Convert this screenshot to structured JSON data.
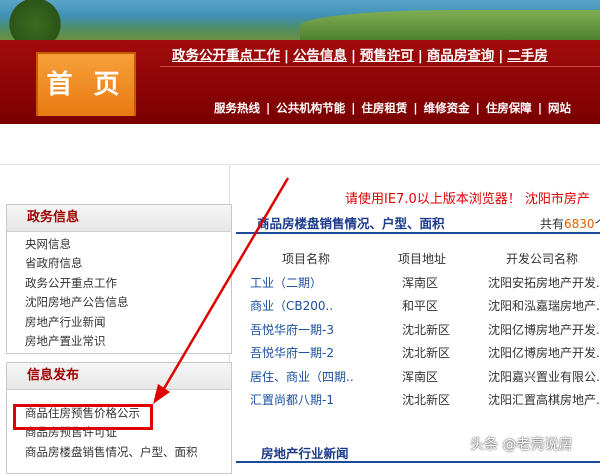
{
  "header": {
    "nav_top": [
      "政务公开重点工作",
      "公告信息",
      "预售许可",
      "商品房查询",
      "二手房"
    ],
    "home_tab": "首 页",
    "nav_bottom": [
      "服务热线",
      "公共机构节能",
      "住房租赁",
      "维修资金",
      "住房保障",
      "网站"
    ]
  },
  "notice": "请使用IE7.0以上版本浏览器！ 沈阳市房产",
  "sidebar": {
    "gov_info": {
      "title": "政务信息",
      "items": [
        "央网信息",
        "省政府信息",
        "政务公开重点工作",
        "沈阳房地产公告信息",
        "房地产行业新闻",
        "房地产置业常识"
      ]
    },
    "info_release": {
      "title": "信息发布",
      "items": [
        "商品住房预售价格公示",
        "商品房预售许可证",
        "商品房楼盘销售情况、户型、面积"
      ]
    }
  },
  "sales": {
    "title": "商品房楼盘销售情况、户型、面积",
    "count_prefix": "共有",
    "count": "6830",
    "count_suffix": "个",
    "columns": [
      "项目名称",
      "项目地址",
      "开发公司名称"
    ],
    "rows": [
      [
        "工业（二期）",
        "浑南区",
        "沈阳安拓房地产开发..."
      ],
      [
        "商业（CB200..",
        "和平区",
        "沈阳和泓嘉瑞房地产..."
      ],
      [
        "吾悦华府一期-3",
        "沈北新区",
        "沈阳亿博房地产开发..."
      ],
      [
        "吾悦华府一期-2",
        "沈北新区",
        "沈阳亿博房地产开发..."
      ],
      [
        "居住、商业（四期..",
        "浑南区",
        "沈阳嘉兴置业有限公..."
      ],
      [
        "汇置尚都八期-1",
        "沈北新区",
        "沈阳汇置高棋房地产..."
      ]
    ]
  },
  "news": {
    "title": "房地产行业新闻"
  },
  "watermark": "头条 @老亮说房",
  "colors": {
    "brand_red": "#8e0000",
    "home_orange": "#f08a1e",
    "link_blue": "#1a4fa0",
    "highlight_red": "#e00000"
  }
}
